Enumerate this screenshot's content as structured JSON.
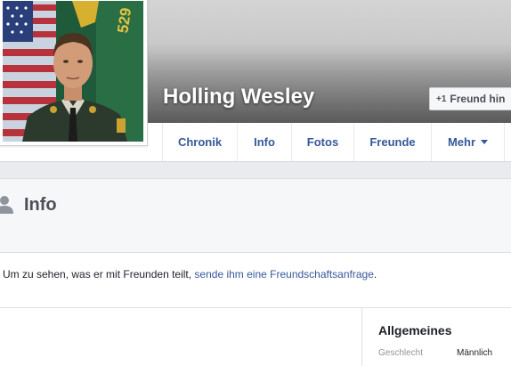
{
  "profile": {
    "name": "Holling Wesley",
    "add_friend_label": "Freund hin"
  },
  "nav": {
    "tabs": [
      {
        "label": "Chronik"
      },
      {
        "label": "Info"
      },
      {
        "label": "Fotos"
      },
      {
        "label": "Freunde"
      },
      {
        "label": "Mehr"
      }
    ]
  },
  "info": {
    "title": "Info",
    "notice_text": "Um zu sehen, was er mit Freunden teilt, ",
    "notice_link": "sende ihm eine Freundschaftsanfrage",
    "notice_end": "."
  },
  "general": {
    "title": "Allgemeines",
    "gender_label": "Geschlecht",
    "gender_value": "Männlich"
  },
  "photo": {
    "flag_badge": "529"
  },
  "colors": {
    "link": "#365899",
    "background": "#e9ebee",
    "cover_dark": "#6e6e6e"
  }
}
